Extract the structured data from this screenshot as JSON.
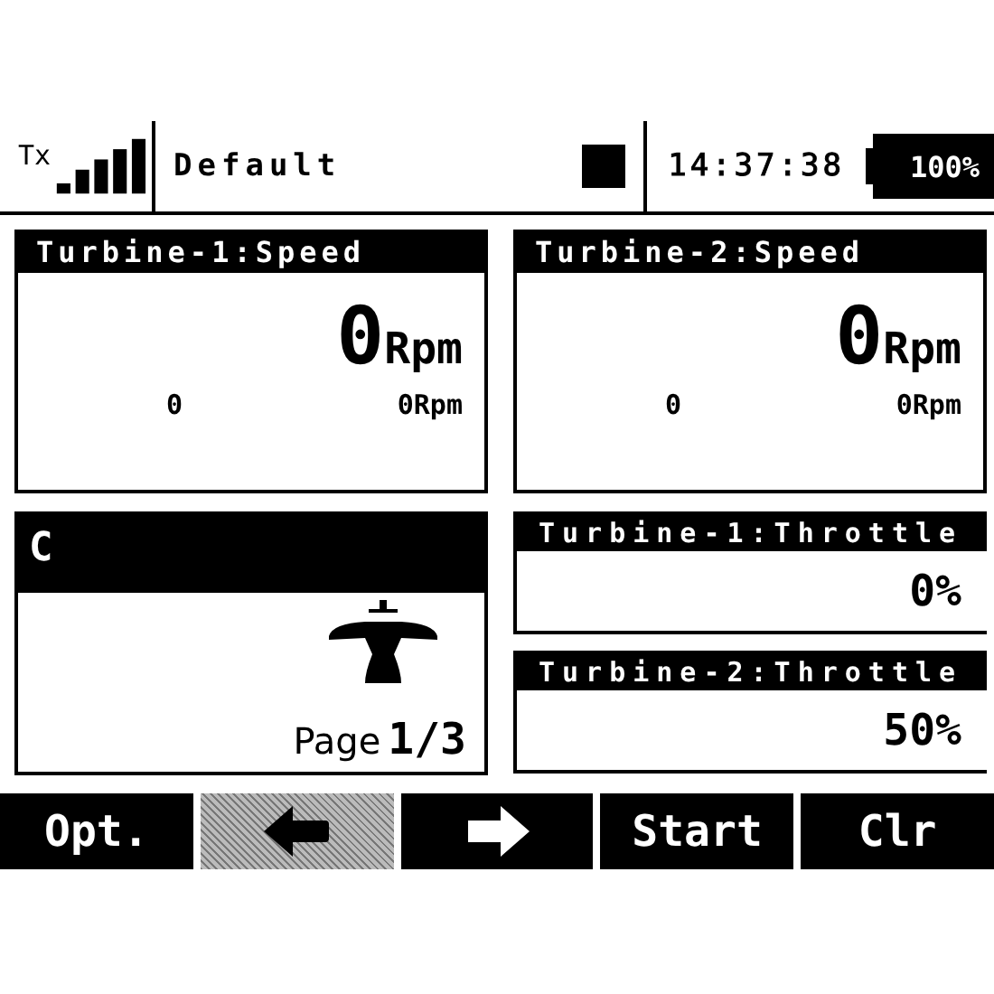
{
  "status_bar": {
    "tx_label": "Tx",
    "model": "Default",
    "time": "14:37:38",
    "battery": "100%"
  },
  "speed_tiles": [
    {
      "title": "Turbine-1:Speed",
      "value": "0",
      "unit": "Rpm",
      "min": "0",
      "max": "0Rpm"
    },
    {
      "title": "Turbine-2:Speed",
      "value": "0",
      "unit": "Rpm",
      "min": "0",
      "max": "0Rpm"
    }
  ],
  "model_tile": {
    "title": "C",
    "page_label": "Page",
    "page": "1/3"
  },
  "throttle_tiles": [
    {
      "title": "Turbine-1:Throttle",
      "value": "0%"
    },
    {
      "title": "Turbine-2:Throttle",
      "value": "50%"
    }
  ],
  "soft_keys": [
    {
      "kind": "label",
      "label": "Opt.",
      "disabled": false
    },
    {
      "kind": "left-arrow",
      "disabled": true
    },
    {
      "kind": "right-arrow",
      "disabled": false
    },
    {
      "kind": "label",
      "label": "Start",
      "disabled": false
    },
    {
      "kind": "label",
      "label": "Clr",
      "disabled": false
    }
  ]
}
